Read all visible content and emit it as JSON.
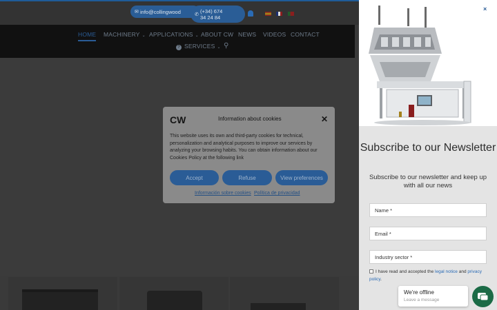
{
  "topbar": {
    "email": "info@collingwood",
    "phone_line1": "(+34) 674",
    "phone_line2": "34 24 84"
  },
  "nav": {
    "items": [
      {
        "label": "HOME",
        "active": true
      },
      {
        "label": "MACHINERY",
        "dropdown": true
      },
      {
        "label": "APPLICATIONS",
        "dropdown": true
      },
      {
        "label": "ABOUT CW"
      },
      {
        "label": "NEWS"
      },
      {
        "label": "VIDEOS"
      },
      {
        "label": "CONTACT"
      }
    ],
    "services": "SERVICES"
  },
  "cookie_modal": {
    "logo": "CW",
    "title": "Information about cookies",
    "text": "This website uses its own and third-party cookies for technical, personalization and analytical purposes to improve our services by analyzing your browsing habits. You can obtain information about our Cookies Policy at the following link",
    "buttons": {
      "accept": "Accept",
      "refuse": "Refuse",
      "preferences": "View preferences"
    },
    "links": {
      "cookies": "Información sobre cookies",
      "privacy": "Política de privacidad"
    }
  },
  "newsletter": {
    "close": "×",
    "title": "Subscribe to our Newsletter",
    "subtitle": "Subscribe to our newsletter and keep up with all our news",
    "name_placeholder": "Name *",
    "email_placeholder": "Email *",
    "sector_placeholder": "Industry sector *",
    "consent_prefix": "I have read and accepted the ",
    "consent_legal": "legal notice",
    "consent_and": " and ",
    "consent_privacy": "privacy policy",
    "consent_suffix": "."
  },
  "chat": {
    "status": "We're offline",
    "action": "Leave a message"
  },
  "colors": {
    "brand_blue": "#2a5c96",
    "chat_green": "#1b6b46"
  }
}
